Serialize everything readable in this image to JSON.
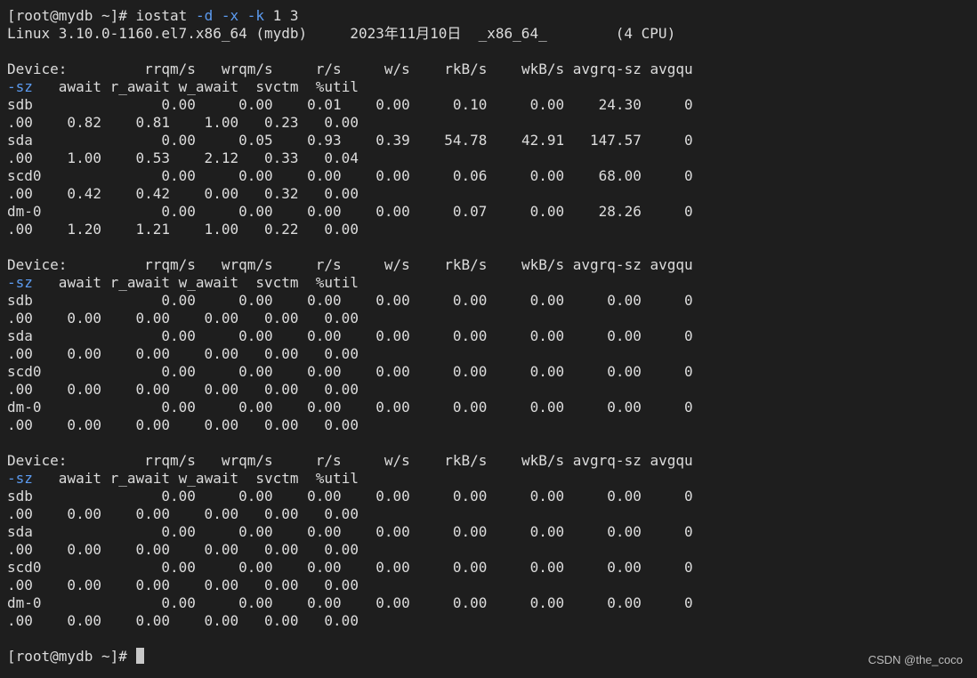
{
  "prompt": {
    "user_host": "[root@mydb ~]#",
    "command": "iostat",
    "flags": [
      "-d",
      "-x",
      "-k"
    ],
    "args": "1 3"
  },
  "system_line": "Linux 3.10.0-1160.el7.x86_64 (mydb)     2023年11月10日  _x86_64_        (4 CPU)",
  "header": {
    "line1": "Device:         rrqm/s   wrqm/s     r/s     w/s    rkB/s    wkB/s avgrq-sz avgqu",
    "wrap_prefix": "-sz",
    "wrap_rest": "   await r_await w_await  svctm  %util"
  },
  "samples": [
    {
      "rows": [
        {
          "line1": "sdb               0.00     0.00    0.01    0.00     0.10     0.00    24.30     0",
          "line2": ".00    0.82    0.81    1.00   0.23   0.00"
        },
        {
          "line1": "sda               0.00     0.05    0.93    0.39    54.78    42.91   147.57     0",
          "line2": ".00    1.00    0.53    2.12   0.33   0.04"
        },
        {
          "line1": "scd0              0.00     0.00    0.00    0.00     0.06     0.00    68.00     0",
          "line2": ".00    0.42    0.42    0.00   0.32   0.00"
        },
        {
          "line1": "dm-0              0.00     0.00    0.00    0.00     0.07     0.00    28.26     0",
          "line2": ".00    1.20    1.21    1.00   0.22   0.00"
        }
      ]
    },
    {
      "rows": [
        {
          "line1": "sdb               0.00     0.00    0.00    0.00     0.00     0.00     0.00     0",
          "line2": ".00    0.00    0.00    0.00   0.00   0.00"
        },
        {
          "line1": "sda               0.00     0.00    0.00    0.00     0.00     0.00     0.00     0",
          "line2": ".00    0.00    0.00    0.00   0.00   0.00"
        },
        {
          "line1": "scd0              0.00     0.00    0.00    0.00     0.00     0.00     0.00     0",
          "line2": ".00    0.00    0.00    0.00   0.00   0.00"
        },
        {
          "line1": "dm-0              0.00     0.00    0.00    0.00     0.00     0.00     0.00     0",
          "line2": ".00    0.00    0.00    0.00   0.00   0.00"
        }
      ]
    },
    {
      "rows": [
        {
          "line1": "sdb               0.00     0.00    0.00    0.00     0.00     0.00     0.00     0",
          "line2": ".00    0.00    0.00    0.00   0.00   0.00"
        },
        {
          "line1": "sda               0.00     0.00    0.00    0.00     0.00     0.00     0.00     0",
          "line2": ".00    0.00    0.00    0.00   0.00   0.00"
        },
        {
          "line1": "scd0              0.00     0.00    0.00    0.00     0.00     0.00     0.00     0",
          "line2": ".00    0.00    0.00    0.00   0.00   0.00"
        },
        {
          "line1": "dm-0              0.00     0.00    0.00    0.00     0.00     0.00     0.00     0",
          "line2": ".00    0.00    0.00    0.00   0.00   0.00"
        }
      ]
    }
  ],
  "final_prompt": "[root@mydb ~]#",
  "watermark": "CSDN @the_coco",
  "colors": {
    "background": "#1e1e1e",
    "text": "#dcdcdc",
    "flag": "#5c9bf0",
    "cursor": "#c8c8c8"
  }
}
